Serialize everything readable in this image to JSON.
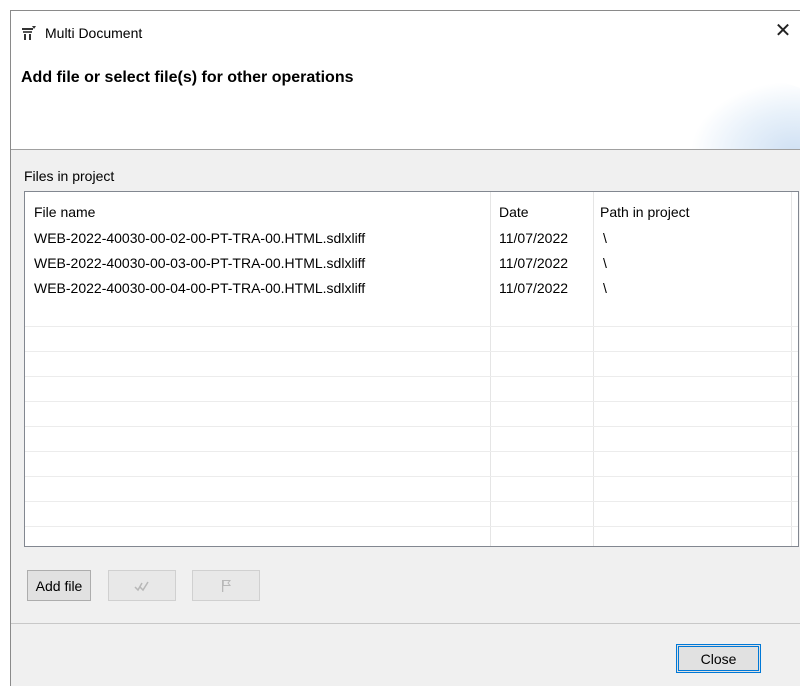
{
  "window": {
    "title": "Multi Document",
    "close_glyph": "✕"
  },
  "banner": {
    "heading": "Add file or select file(s) for other operations"
  },
  "files_group": {
    "label": "Files in project",
    "columns": [
      "File name",
      "Date",
      "Path in project"
    ],
    "rows": [
      {
        "name": "WEB-2022-40030-00-02-00-PT-TRA-00.HTML.sdlxliff",
        "date": "11/07/2022",
        "path": "\\"
      },
      {
        "name": "WEB-2022-40030-00-03-00-PT-TRA-00.HTML.sdlxliff",
        "date": "11/07/2022",
        "path": "\\"
      },
      {
        "name": "WEB-2022-40030-00-04-00-PT-TRA-00.HTML.sdlxliff",
        "date": "11/07/2022",
        "path": "\\"
      }
    ]
  },
  "toolbar": {
    "add_file_label": "Add file",
    "check_icon": "checkmarks-icon",
    "flag_icon": "flag-icon"
  },
  "footer": {
    "close_label": "Close"
  },
  "colors": {
    "accent": "#0078d7",
    "dialog_bg": "#f0f0f0"
  }
}
